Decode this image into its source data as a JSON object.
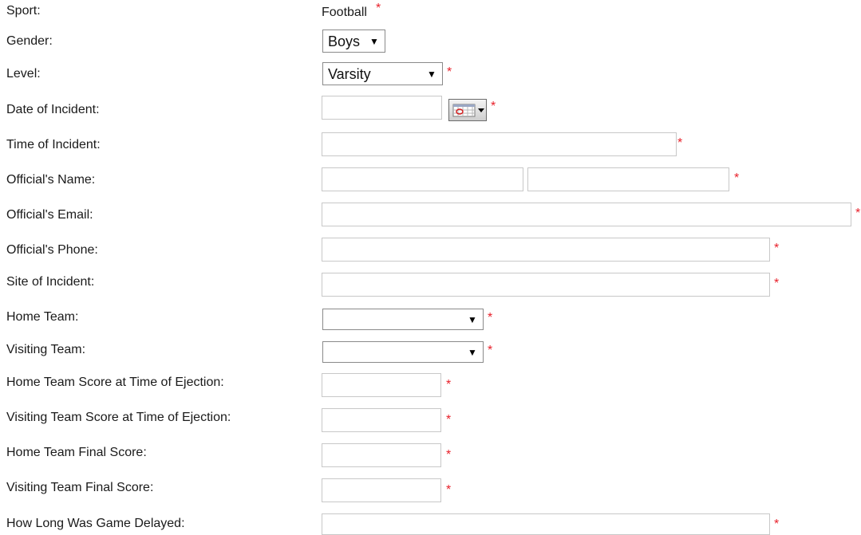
{
  "form": {
    "required_marker": "*",
    "sport": {
      "label": "Sport:",
      "value": "Football"
    },
    "gender": {
      "label": "Gender:",
      "value": "Boys"
    },
    "level": {
      "label": "Level:",
      "value": "Varsity"
    },
    "date_of_incident": {
      "label": "Date of Incident:",
      "value": ""
    },
    "time_of_incident": {
      "label": "Time of Incident:",
      "value": ""
    },
    "officials_name": {
      "label": "Official's Name:",
      "first_value": "",
      "last_value": ""
    },
    "officials_email": {
      "label": "Official's Email:",
      "value": ""
    },
    "officials_phone": {
      "label": "Official's Phone:",
      "value": ""
    },
    "site_of_incident": {
      "label": "Site of Incident:",
      "value": ""
    },
    "home_team": {
      "label": "Home Team:",
      "value": ""
    },
    "visiting_team": {
      "label": "Visiting Team:",
      "value": ""
    },
    "home_score_ejection": {
      "label": "Home Team Score at Time of Ejection:",
      "value": ""
    },
    "visiting_score_ejection": {
      "label": "Visiting Team Score at Time of Ejection:",
      "value": ""
    },
    "home_final_score": {
      "label": "Home Team Final Score:",
      "value": ""
    },
    "visiting_final_score": {
      "label": "Visiting Team Final Score:",
      "value": ""
    },
    "game_delay": {
      "label": "How Long Was Game Delayed:",
      "value": ""
    }
  },
  "icons": {
    "dropdown_arrow": "down-triangle-icon",
    "calendar": "calendar-icon"
  },
  "colors": {
    "required_marker": "#e8202a",
    "input_border": "#c8c8c8"
  }
}
